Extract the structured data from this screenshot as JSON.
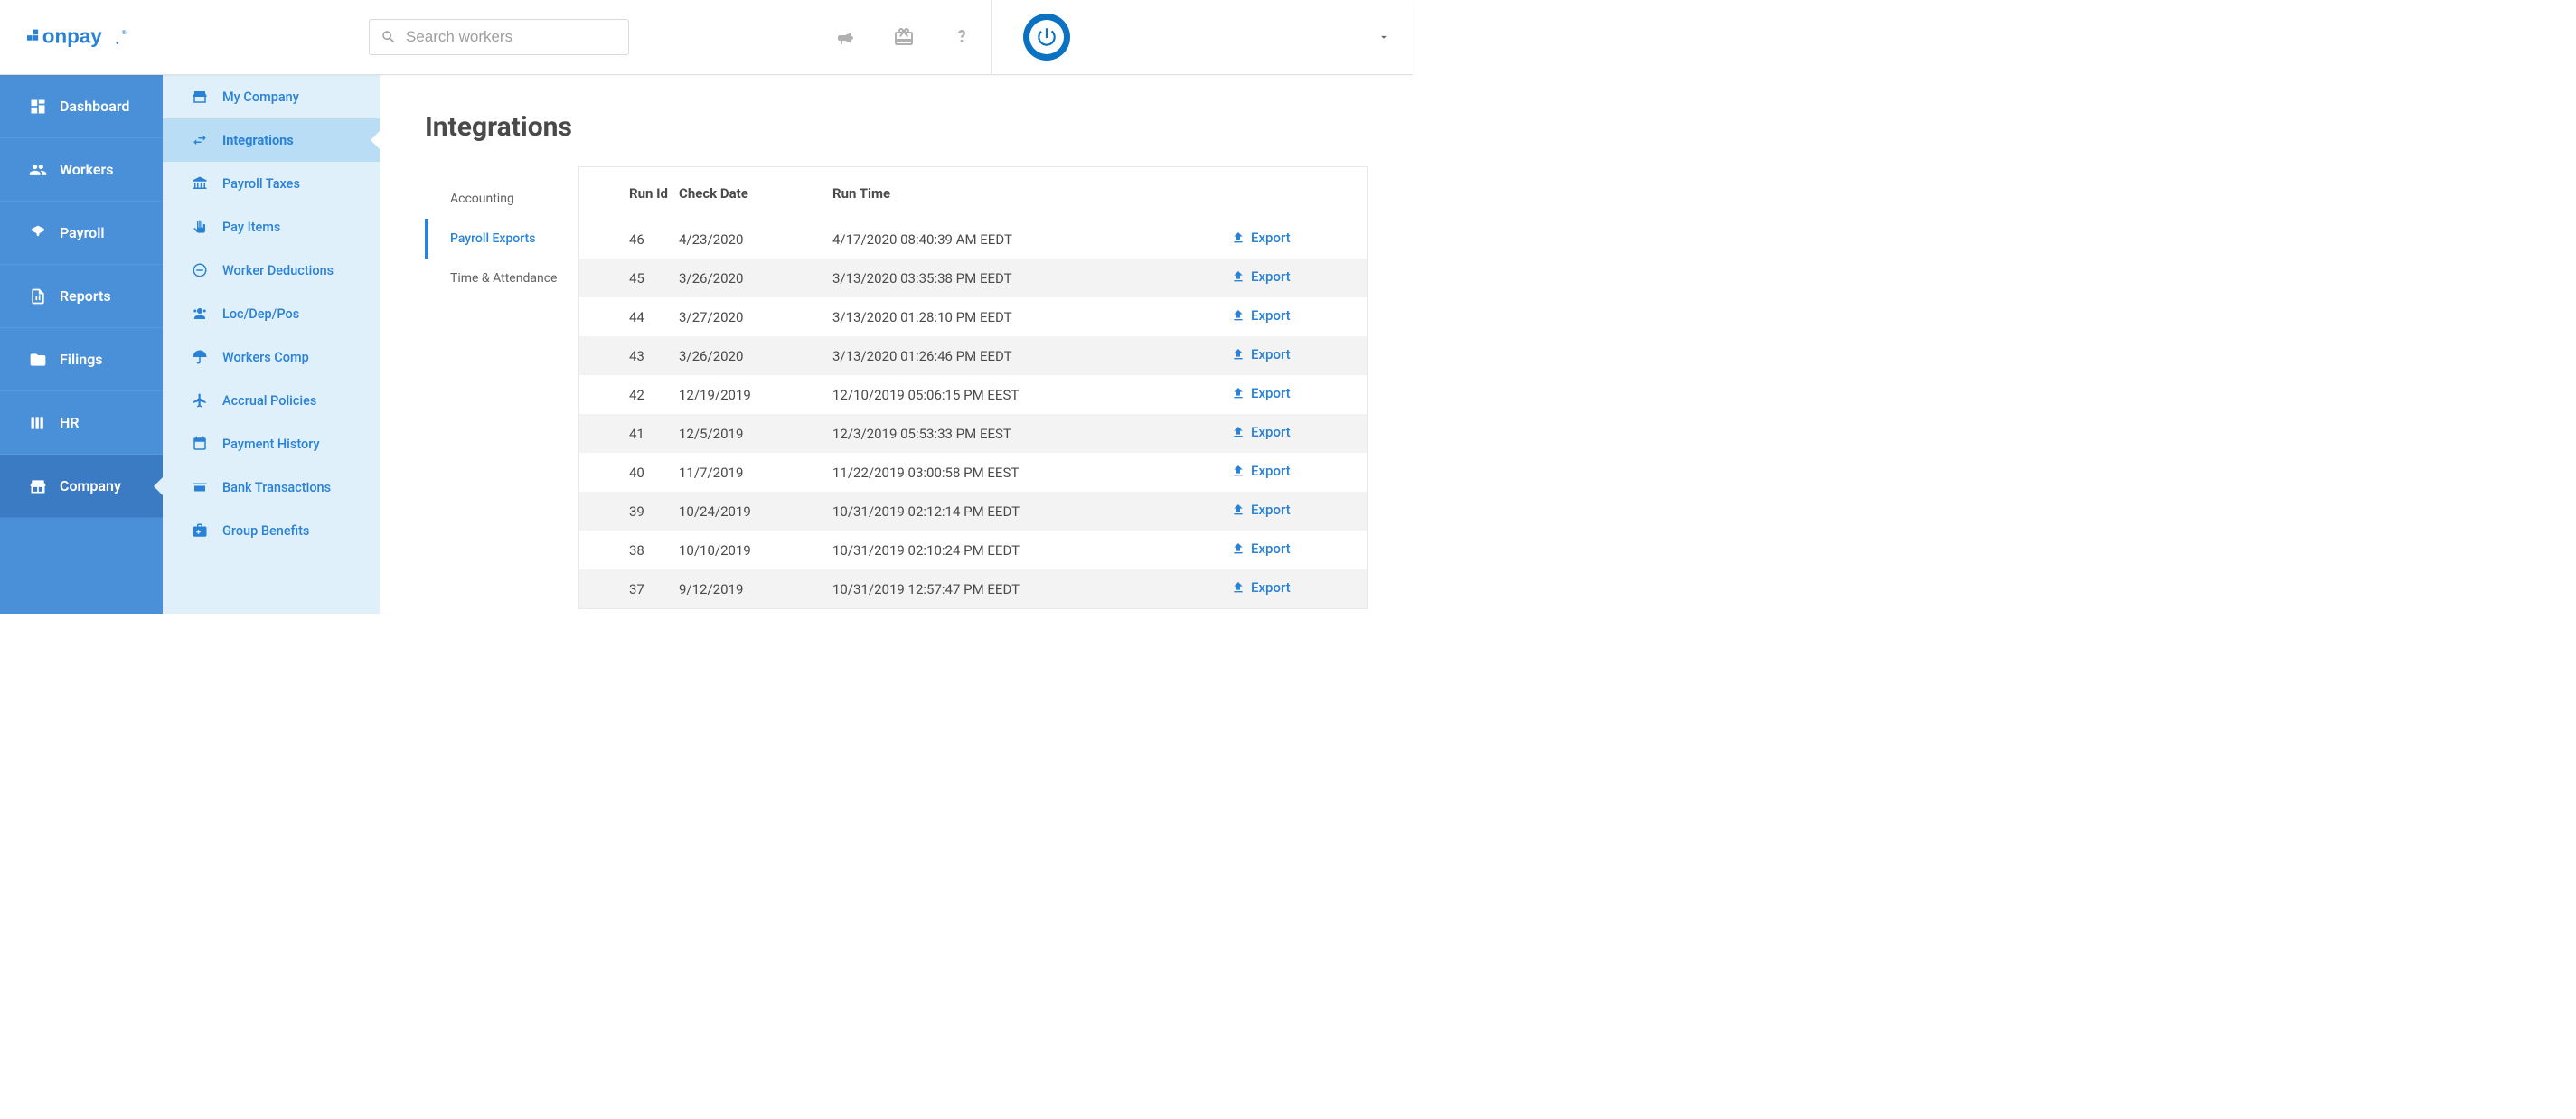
{
  "header": {
    "logo_text": "onpay",
    "search_placeholder": "Search workers"
  },
  "sidebar_primary": [
    {
      "label": "Dashboard",
      "icon": "grid-icon"
    },
    {
      "label": "Workers",
      "icon": "workers-icon"
    },
    {
      "label": "Payroll",
      "icon": "payroll-icon"
    },
    {
      "label": "Reports",
      "icon": "reports-icon"
    },
    {
      "label": "Filings",
      "icon": "filings-icon"
    },
    {
      "label": "HR",
      "icon": "hr-icon"
    },
    {
      "label": "Company",
      "icon": "company-icon"
    }
  ],
  "sidebar_primary_active": 6,
  "sidebar_secondary": [
    {
      "label": "My Company",
      "icon": "storefront-icon"
    },
    {
      "label": "Integrations",
      "icon": "swap-icon"
    },
    {
      "label": "Payroll Taxes",
      "icon": "bank-icon"
    },
    {
      "label": "Pay Items",
      "icon": "hand-icon"
    },
    {
      "label": "Worker Deductions",
      "icon": "deduction-icon"
    },
    {
      "label": "Loc/Dep/Pos",
      "icon": "people-icon"
    },
    {
      "label": "Workers Comp",
      "icon": "umbrella-icon"
    },
    {
      "label": "Accrual Policies",
      "icon": "plane-icon"
    },
    {
      "label": "Payment History",
      "icon": "history-icon"
    },
    {
      "label": "Bank Transactions",
      "icon": "transactions-icon"
    },
    {
      "label": "Group Benefits",
      "icon": "benefits-icon"
    }
  ],
  "sidebar_secondary_active": 1,
  "page_title": "Integrations",
  "sub_tabs": [
    {
      "label": "Accounting"
    },
    {
      "label": "Payroll Exports"
    },
    {
      "label": "Time & Attendance"
    }
  ],
  "sub_tab_active": 1,
  "table": {
    "columns": [
      "Run Id",
      "Check Date",
      "Run Time",
      ""
    ],
    "export_label": "Export",
    "rows": [
      {
        "id": "46",
        "check_date": "4/23/2020",
        "run_time": "4/17/2020 08:40:39 AM EEDT"
      },
      {
        "id": "45",
        "check_date": "3/26/2020",
        "run_time": "3/13/2020 03:35:38 PM EEDT"
      },
      {
        "id": "44",
        "check_date": "3/27/2020",
        "run_time": "3/13/2020 01:28:10 PM EEDT"
      },
      {
        "id": "43",
        "check_date": "3/26/2020",
        "run_time": "3/13/2020 01:26:46 PM EEDT"
      },
      {
        "id": "42",
        "check_date": "12/19/2019",
        "run_time": "12/10/2019 05:06:15 PM EEST"
      },
      {
        "id": "41",
        "check_date": "12/5/2019",
        "run_time": "12/3/2019 05:53:33 PM EEST"
      },
      {
        "id": "40",
        "check_date": "11/7/2019",
        "run_time": "11/22/2019 03:00:58 PM EEST"
      },
      {
        "id": "39",
        "check_date": "10/24/2019",
        "run_time": "10/31/2019 02:12:14 PM EEDT"
      },
      {
        "id": "38",
        "check_date": "10/10/2019",
        "run_time": "10/31/2019 02:10:24 PM EEDT"
      },
      {
        "id": "37",
        "check_date": "9/12/2019",
        "run_time": "10/31/2019 12:57:47 PM EEDT"
      }
    ]
  },
  "colors": {
    "primary_blue": "#2a82d6",
    "sidebar_blue": "#4a90d9",
    "sidebar_light": "#dff0fb"
  }
}
